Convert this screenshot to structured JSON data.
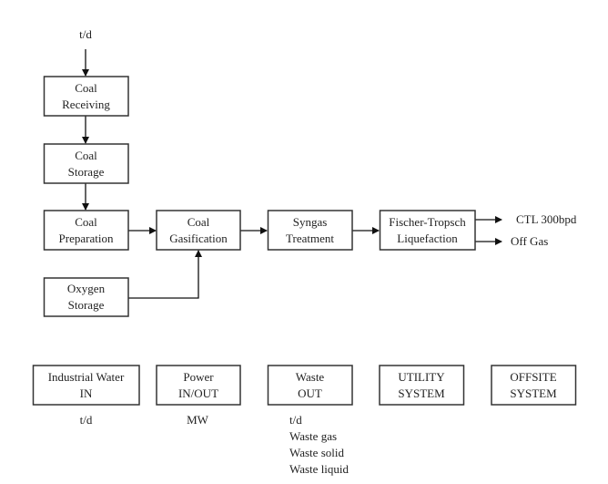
{
  "input_label": "t/d",
  "process_blocks": {
    "coal_receiving": [
      "Coal",
      "Receiving"
    ],
    "coal_storage": [
      "Coal",
      "Storage"
    ],
    "coal_preparation": [
      "Coal",
      "Preparation"
    ],
    "coal_gasification": [
      "Coal",
      "Gasification"
    ],
    "syngas_treatment": [
      "Syngas",
      "Treatment"
    ],
    "ft_liquefaction": [
      "Fischer-Tropsch",
      "Liquefaction"
    ],
    "oxygen_storage": [
      "Oxygen",
      "Storage"
    ]
  },
  "outputs": {
    "product": "CTL 300bpd",
    "off_gas": "Off Gas"
  },
  "support_blocks": [
    {
      "lines": [
        "Industrial Water",
        "IN"
      ],
      "notes": [
        "t/d"
      ]
    },
    {
      "lines": [
        "Power",
        "IN/OUT"
      ],
      "notes": [
        "MW"
      ]
    },
    {
      "lines": [
        "Waste",
        "OUT"
      ],
      "notes": [
        "t/d",
        "Waste gas",
        "Waste solid",
        "Waste liquid"
      ]
    },
    {
      "lines": [
        "UTILITY",
        "SYSTEM"
      ],
      "notes": []
    },
    {
      "lines": [
        "OFFSITE",
        "SYSTEM"
      ],
      "notes": []
    }
  ]
}
